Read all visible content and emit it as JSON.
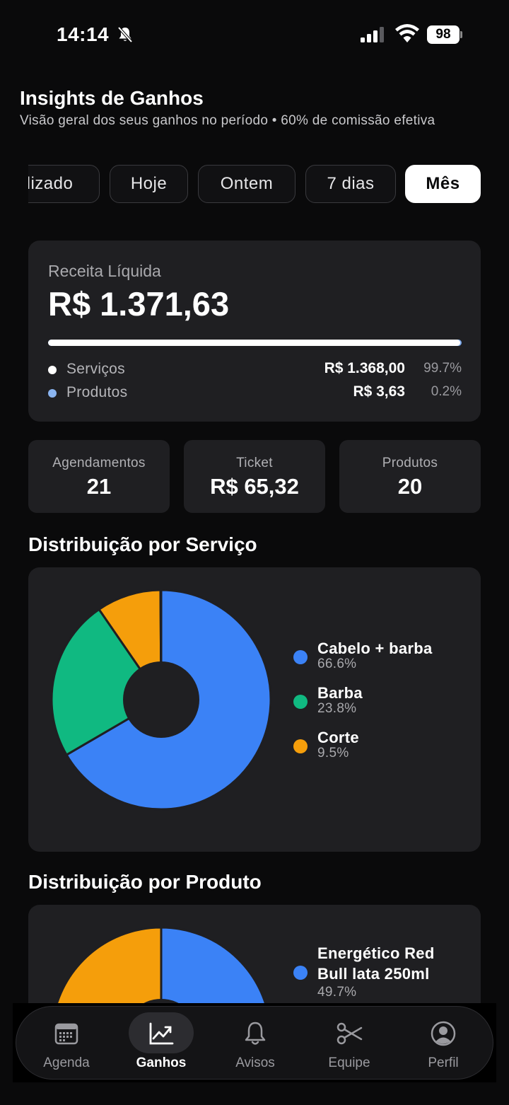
{
  "status_bar": {
    "time": "14:14",
    "battery": "98"
  },
  "header": {
    "title": "Insights de Ganhos",
    "subtitle": "Visão geral dos seus ganhos no período • 60% de comissão efetiva"
  },
  "periods": [
    "lizado",
    "Hoje",
    "Ontem",
    "7 dias",
    "Mês"
  ],
  "selected_period": "Mês",
  "revenue": {
    "label": "Receita Líquida",
    "value": "R$ 1.371,63",
    "services_share": 0.997,
    "rows": [
      {
        "name": "Serviços",
        "amount": "R$ 1.368,00",
        "pct": "99.7%",
        "color": "#ffffff"
      },
      {
        "name": "Produtos",
        "amount": "R$ 3,63",
        "pct": "0.2%",
        "color": "#8ab4f0"
      }
    ]
  },
  "stats": [
    {
      "label": "Agendamentos",
      "value": "21"
    },
    {
      "label": "Ticket",
      "value": "R$ 65,32"
    },
    {
      "label": "Produtos",
      "value": "20"
    }
  ],
  "chart_data": [
    {
      "type": "pie",
      "title": "Distribuição por Serviço",
      "categories": [
        "Cabelo + barba",
        "Barba",
        "Corte"
      ],
      "values": [
        66.6,
        23.8,
        9.5
      ],
      "labels": [
        "66.6%",
        "23.8%",
        "9.5%"
      ],
      "colors": [
        "#3b82f6",
        "#10b981",
        "#f59e0b"
      ]
    },
    {
      "type": "pie",
      "title": "Distribuição por Produto",
      "categories": [
        "Energético Red Bull lata 250ml"
      ],
      "values": [
        49.7
      ],
      "labels": [
        "49.7%"
      ],
      "colors": [
        "#3b82f6",
        "#f59e0b"
      ]
    }
  ],
  "product_legend": {
    "name_line1": "Energético Red",
    "name_line2": "Bull lata 250ml"
  },
  "tabs": [
    {
      "label": "Agenda",
      "icon": "calendar-icon"
    },
    {
      "label": "Ganhos",
      "icon": "chart-trend-icon"
    },
    {
      "label": "Avisos",
      "icon": "bell-icon"
    },
    {
      "label": "Equipe",
      "icon": "scissors-icon"
    },
    {
      "label": "Perfil",
      "icon": "user-circle-icon"
    }
  ],
  "active_tab": "Ganhos"
}
